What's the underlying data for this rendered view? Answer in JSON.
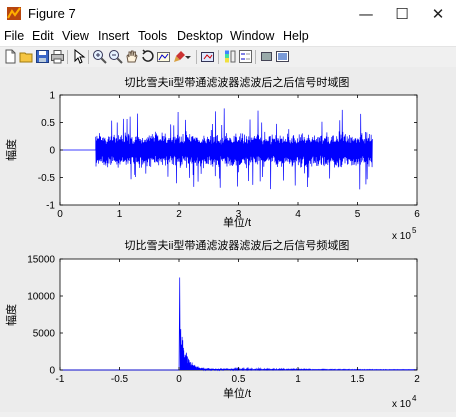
{
  "window": {
    "title": "Figure 7",
    "minimize_glyph": "—",
    "maximize_glyph": "☐",
    "close_glyph": "✕"
  },
  "menu": [
    "File",
    "Edit",
    "View",
    "Insert",
    "Tools",
    "Desktop",
    "Window",
    "Help"
  ],
  "toolbar_icons": [
    "new-figure-icon",
    "open-file-icon",
    "save-icon",
    "print-icon",
    "edit-plot-arrow-icon",
    "zoom-in-icon",
    "zoom-out-icon",
    "pan-hand-icon",
    "rotate-3d-icon",
    "data-cursor-icon",
    "brush-icon",
    "link-plot-icon",
    "colorbar-icon",
    "legend-icon",
    "hide-plot-tools-icon",
    "show-plot-tools-icon"
  ],
  "colors": {
    "trace": "#0000ff",
    "axes_bg": "#ffffff",
    "figure_bg": "#ececec"
  },
  "chart_data": [
    {
      "type": "line",
      "title": "切比雪夫ii型带通滤波器滤波后之后信号时域图",
      "xlabel": "",
      "ylabel": "幅度",
      "xlim": [
        0,
        600000
      ],
      "ylim": [
        -1,
        1
      ],
      "x_ticks": [
        "0",
        "1",
        "2",
        "3",
        "4",
        "5",
        "6"
      ],
      "y_ticks": [
        "-1",
        "-0.5",
        "0",
        "0.5",
        "1"
      ],
      "x_exponent": "x 10",
      "x_exponent_power": "5",
      "signal": {
        "flat_until": 60000,
        "active_until": 525000,
        "typical_amplitude": 0.3,
        "peak_amplitude": 0.8
      }
    },
    {
      "type": "line",
      "title": "切比雪夫ii型带通滤波器滤波后之后信号频域图",
      "xlabel": "单位/t",
      "ylabel": "幅度",
      "xlim": [
        -10000,
        20000
      ],
      "ylim": [
        0,
        15000
      ],
      "x_ticks": [
        "-1",
        "-0.5",
        "0",
        "0.5",
        "1",
        "1.5",
        "2"
      ],
      "y_ticks": [
        "0",
        "5000",
        "10000",
        "15000"
      ],
      "x_exponent": "x 10",
      "x_exponent_power": "4",
      "spectrum": {
        "peak_x": 60,
        "peak_value": 12500
      }
    }
  ],
  "plot1_xlabel": "单位/t"
}
